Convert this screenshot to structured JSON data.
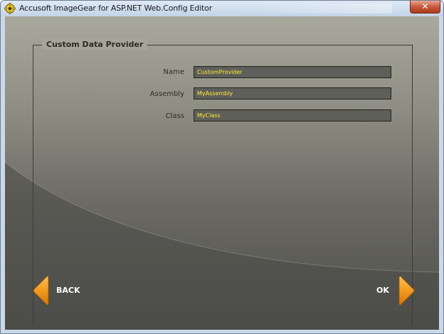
{
  "window": {
    "title": "Accusoft ImageGear for ASP.NET Web.Config Editor",
    "close_glyph": "✕",
    "app_icon": "gear-icon"
  },
  "group": {
    "title": "Custom Data Provider"
  },
  "fields": [
    {
      "label": "Name",
      "value": "CustomProvider"
    },
    {
      "label": "Assembly",
      "value": "MyAssembly"
    },
    {
      "label": "Class",
      "value": "MyClass"
    }
  ],
  "nav": {
    "back_label": "BACK",
    "ok_label": "OK",
    "back_icon": "arrow-left-icon",
    "ok_icon": "arrow-right-icon"
  },
  "colors": {
    "arrow": "#f29a1e",
    "input_text": "#ffea3a"
  }
}
